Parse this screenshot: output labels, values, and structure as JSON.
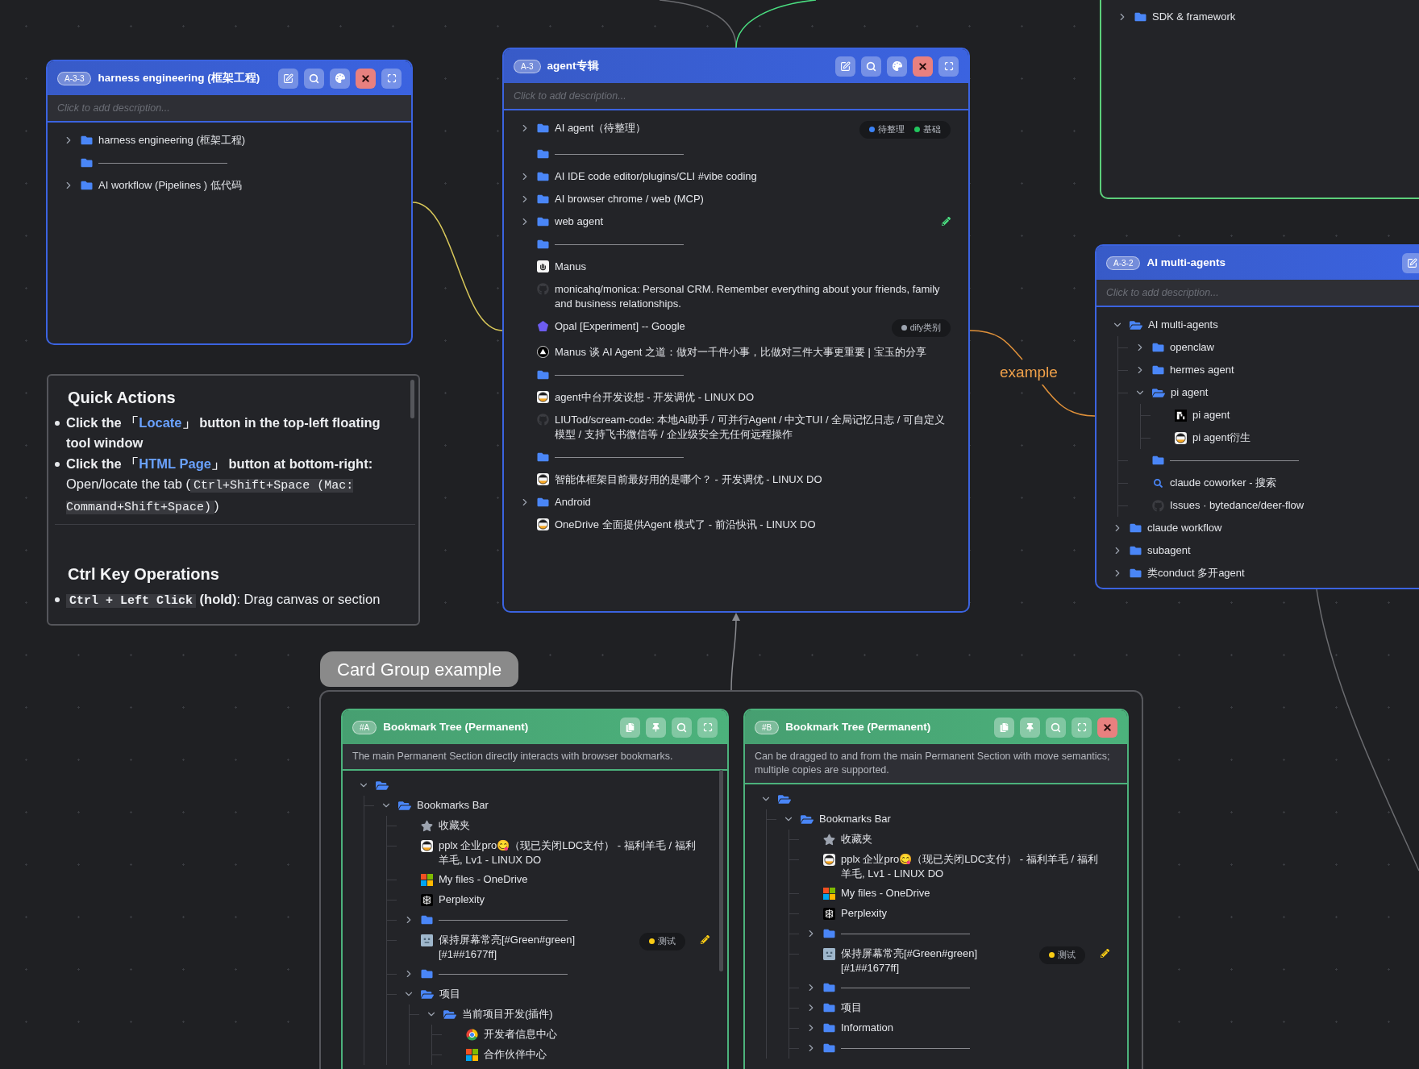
{
  "top_card": {
    "items": [
      {
        "kind": "folder",
        "label": "SDK & framework",
        "expanded": false
      }
    ]
  },
  "cards": [
    {
      "color": "#3b63e0",
      "badge": "A-3-3",
      "title": "harness engineering (框架工程)",
      "placeholder": "Click to add description...",
      "buttons": [
        {
          "kind": "edit"
        },
        {
          "kind": "search"
        },
        {
          "kind": "palette"
        },
        {
          "kind": "close"
        },
        {
          "kind": "fullscreen"
        }
      ],
      "items": [
        {
          "kind": "folder",
          "label": "harness engineering (框架工程)",
          "expanded": false
        },
        {
          "kind": "divider"
        },
        {
          "kind": "folder",
          "label": "AI workflow (Pipelines ) 低代码",
          "expanded": false
        }
      ]
    },
    {
      "color": "#3b63e0",
      "badge": "A-3",
      "title": "agent专辑",
      "placeholder": "Click to add description...",
      "buttons": [
        {
          "kind": "edit"
        },
        {
          "kind": "search"
        },
        {
          "kind": "palette"
        },
        {
          "kind": "close"
        },
        {
          "kind": "fullscreen"
        }
      ],
      "items": [
        {
          "kind": "folder",
          "label": "AI agent（待整理）",
          "expanded": false,
          "tags": [
            {
              "label": "待整理",
              "color": "#3b82f6"
            },
            {
              "label": "基础",
              "color": "#22c55e"
            }
          ]
        },
        {
          "kind": "divider"
        },
        {
          "kind": "folder",
          "label": "AI IDE code editor/plugins/CLI #vibe coding",
          "expanded": false
        },
        {
          "kind": "folder",
          "label": "AI browser chrome / web (MCP)",
          "expanded": false
        },
        {
          "kind": "folder",
          "label": "web agent",
          "expanded": false,
          "edited": true
        },
        {
          "kind": "divider"
        },
        {
          "kind": "manus",
          "label": "Manus"
        },
        {
          "kind": "github",
          "label": "monicahq/monica: Personal CRM. Remember everything about your friends, family and business relationships."
        },
        {
          "kind": "opal",
          "label": "Opal [Experiment] -- Google",
          "tags": [
            {
              "label": "dify类别",
              "color": "#9ca3af"
            }
          ]
        },
        {
          "kind": "triangle",
          "label": "Manus 谈 AI Agent 之道：做对一千件小事，比做对三件大事更重要 | 宝玉的分享"
        },
        {
          "kind": "divider"
        },
        {
          "kind": "linuxdo",
          "label": "agent中台开发设想 - 开发调优 - LINUX DO"
        },
        {
          "kind": "github",
          "label": "LIUTod/scream-code: 本地Ai助手 / 可并行Agent / 中文TUI / 全局记忆日志 / 可自定义模型 / 支持飞书微信等 / 企业级安全无任何远程操作"
        },
        {
          "kind": "divider"
        },
        {
          "kind": "linuxdo",
          "label": "智能体框架目前最好用的是哪个？ - 开发调优 - LINUX DO"
        },
        {
          "kind": "folder",
          "label": "Android",
          "expanded": false
        },
        {
          "kind": "linuxdo",
          "label": "OneDrive 全面提供Agent 模式了 - 前沿快讯 - LINUX DO"
        }
      ]
    },
    {
      "color": "#3b63e0",
      "badge": "A-3-2",
      "title": "AI multi-agents",
      "placeholder": "Click to add description...",
      "buttons": [
        {
          "kind": "edit"
        }
      ],
      "items": [
        {
          "kind": "folder",
          "label": "AI multi-agents",
          "expanded": true,
          "children": [
            {
              "kind": "folder",
              "label": "openclaw",
              "expanded": false
            },
            {
              "kind": "folder",
              "label": "hermes agent",
              "expanded": false
            },
            {
              "kind": "folder",
              "label": "pi agent",
              "expanded": true,
              "children": [
                {
                  "kind": "pi",
                  "label": "pi agent"
                },
                {
                  "kind": "linuxdo",
                  "label": "pi agent衍生"
                }
              ]
            },
            {
              "kind": "divider"
            },
            {
              "kind": "search",
              "label": "claude coworker - 搜索"
            },
            {
              "kind": "github",
              "label": "Issues · bytedance/deer-flow"
            }
          ]
        },
        {
          "kind": "folder",
          "label": "claude workflow",
          "expanded": false
        },
        {
          "kind": "folder",
          "label": "subagent",
          "expanded": false
        },
        {
          "kind": "folder",
          "label": "类conduct 多开agent",
          "expanded": false
        }
      ]
    }
  ],
  "note": {
    "sections": [
      {
        "heading": "Quick Actions",
        "bullets": [
          {
            "segments": [
              {
                "kind": "bold",
                "text": "Click the 「"
              },
              {
                "kind": "link",
                "text": "Locate"
              },
              {
                "kind": "bold",
                "text": "」 button in the top-left floating tool window"
              }
            ]
          },
          {
            "segments": [
              {
                "kind": "bold",
                "text": "Click the 「"
              },
              {
                "kind": "link",
                "text": "HTML Page"
              },
              {
                "kind": "bold",
                "text": "」 button at bottom-right:"
              },
              {
                "kind": "text",
                "text": " Open/locate the tab ("
              },
              {
                "kind": "code",
                "text": "Ctrl+Shift+Space (Mac: Command+Shift+Space)"
              },
              {
                "kind": "text",
                "text": ")"
              }
            ]
          }
        ]
      },
      {
        "heading": "Ctrl Key Operations",
        "bullets": [
          {
            "segments": [
              {
                "kind": "code",
                "text": "Ctrl + Left Click",
                "strong": true
              },
              {
                "kind": "bold",
                "text": " (hold)"
              },
              {
                "kind": "text",
                "text": ": Drag canvas or section"
              }
            ]
          }
        ]
      }
    ]
  },
  "edge_label": "example",
  "group": {
    "title": "Card Group example",
    "cards": [
      {
        "color": "#4cb27c",
        "badge": "#A",
        "title": "Bookmark Tree (Permanent)",
        "description": "The main Permanent Section directly interacts with browser bookmarks.",
        "buttons": [
          {
            "kind": "copy"
          },
          {
            "kind": "pin"
          },
          {
            "kind": "search"
          },
          {
            "kind": "fullscreen"
          }
        ],
        "items": [
          {
            "kind": "folder",
            "expanded": true,
            "children": [
              {
                "kind": "folder",
                "label": "Bookmarks Bar",
                "expanded": true,
                "children": [
                  {
                    "kind": "star",
                    "label": "收藏夹"
                  },
                  {
                    "kind": "linuxdo",
                    "label": "pplx 企业pro😋（现已关闭LDC支付） - 福利羊毛 / 福利羊毛, Lv1 - LINUX DO"
                  },
                  {
                    "kind": "windows",
                    "label": "My files - OneDrive"
                  },
                  {
                    "kind": "perplexity",
                    "label": "Perplexity"
                  },
                  {
                    "kind": "divider",
                    "expanded": false
                  },
                  {
                    "kind": "screen",
                    "label": "保持屏幕常亮[#Green#green][#1##1677ff]",
                    "tags": [
                      {
                        "label": "测试",
                        "color": "#facc15"
                      }
                    ],
                    "edited": true
                  },
                  {
                    "kind": "divider",
                    "expanded": false
                  },
                  {
                    "kind": "folder",
                    "label": "项目",
                    "expanded": true,
                    "children": [
                      {
                        "kind": "folder",
                        "label": "当前项目开发(插件)",
                        "expanded": true,
                        "children": [
                          {
                            "kind": "chrome",
                            "label": "开发者信息中心"
                          },
                          {
                            "kind": "windows",
                            "label": "合作伙伴中心"
                          }
                        ]
                      }
                    ]
                  }
                ]
              }
            ]
          }
        ]
      },
      {
        "color": "#4cb27c",
        "badge": "#B",
        "title": "Bookmark Tree (Permanent)",
        "description": "Can be dragged to and from the main Permanent Section with move semantics; multiple copies are supported.",
        "buttons": [
          {
            "kind": "copy"
          },
          {
            "kind": "pin"
          },
          {
            "kind": "search"
          },
          {
            "kind": "fullscreen"
          },
          {
            "kind": "close"
          }
        ],
        "items": [
          {
            "kind": "folder",
            "expanded": true,
            "children": [
              {
                "kind": "folder",
                "label": "Bookmarks Bar",
                "expanded": true,
                "children": [
                  {
                    "kind": "star",
                    "label": "收藏夹"
                  },
                  {
                    "kind": "linuxdo",
                    "label": "pplx 企业pro😋（现已关闭LDC支付） - 福利羊毛 / 福利羊毛, Lv1 - LINUX DO"
                  },
                  {
                    "kind": "windows",
                    "label": "My files - OneDrive"
                  },
                  {
                    "kind": "perplexity",
                    "label": "Perplexity"
                  },
                  {
                    "kind": "divider",
                    "expanded": false
                  },
                  {
                    "kind": "screen",
                    "label": "保持屏幕常亮[#Green#green][#1##1677ff]",
                    "tags": [
                      {
                        "label": "测试",
                        "color": "#facc15"
                      }
                    ],
                    "edited": true
                  },
                  {
                    "kind": "divider",
                    "expanded": false
                  },
                  {
                    "kind": "folder",
                    "label": "项目",
                    "expanded": false
                  },
                  {
                    "kind": "folder",
                    "label": "Information",
                    "expanded": false
                  },
                  {
                    "kind": "divider",
                    "expanded": false
                  }
                ]
              }
            ]
          }
        ]
      }
    ]
  }
}
